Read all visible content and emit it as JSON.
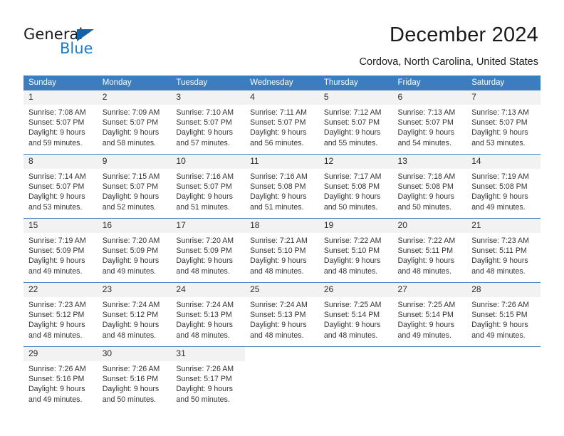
{
  "brand": {
    "name_top": "General",
    "name_bottom": "Blue",
    "accent_color": "#1363a8",
    "blue_text_color": "#1f7ac4"
  },
  "header": {
    "title": "December 2024",
    "subtitle": "Cordova, North Carolina, United States"
  },
  "calendar": {
    "header_background": "#3b7dc0",
    "header_text_color": "#ffffff",
    "daynum_background": "#f2f2f2",
    "weekdays": [
      "Sunday",
      "Monday",
      "Tuesday",
      "Wednesday",
      "Thursday",
      "Friday",
      "Saturday"
    ],
    "weeks": [
      [
        {
          "day": "1",
          "sunrise": "Sunrise: 7:08 AM",
          "sunset": "Sunset: 5:07 PM",
          "daylight_line1": "Daylight: 9 hours",
          "daylight_line2": "and 59 minutes."
        },
        {
          "day": "2",
          "sunrise": "Sunrise: 7:09 AM",
          "sunset": "Sunset: 5:07 PM",
          "daylight_line1": "Daylight: 9 hours",
          "daylight_line2": "and 58 minutes."
        },
        {
          "day": "3",
          "sunrise": "Sunrise: 7:10 AM",
          "sunset": "Sunset: 5:07 PM",
          "daylight_line1": "Daylight: 9 hours",
          "daylight_line2": "and 57 minutes."
        },
        {
          "day": "4",
          "sunrise": "Sunrise: 7:11 AM",
          "sunset": "Sunset: 5:07 PM",
          "daylight_line1": "Daylight: 9 hours",
          "daylight_line2": "and 56 minutes."
        },
        {
          "day": "5",
          "sunrise": "Sunrise: 7:12 AM",
          "sunset": "Sunset: 5:07 PM",
          "daylight_line1": "Daylight: 9 hours",
          "daylight_line2": "and 55 minutes."
        },
        {
          "day": "6",
          "sunrise": "Sunrise: 7:13 AM",
          "sunset": "Sunset: 5:07 PM",
          "daylight_line1": "Daylight: 9 hours",
          "daylight_line2": "and 54 minutes."
        },
        {
          "day": "7",
          "sunrise": "Sunrise: 7:13 AM",
          "sunset": "Sunset: 5:07 PM",
          "daylight_line1": "Daylight: 9 hours",
          "daylight_line2": "and 53 minutes."
        }
      ],
      [
        {
          "day": "8",
          "sunrise": "Sunrise: 7:14 AM",
          "sunset": "Sunset: 5:07 PM",
          "daylight_line1": "Daylight: 9 hours",
          "daylight_line2": "and 53 minutes."
        },
        {
          "day": "9",
          "sunrise": "Sunrise: 7:15 AM",
          "sunset": "Sunset: 5:07 PM",
          "daylight_line1": "Daylight: 9 hours",
          "daylight_line2": "and 52 minutes."
        },
        {
          "day": "10",
          "sunrise": "Sunrise: 7:16 AM",
          "sunset": "Sunset: 5:07 PM",
          "daylight_line1": "Daylight: 9 hours",
          "daylight_line2": "and 51 minutes."
        },
        {
          "day": "11",
          "sunrise": "Sunrise: 7:16 AM",
          "sunset": "Sunset: 5:08 PM",
          "daylight_line1": "Daylight: 9 hours",
          "daylight_line2": "and 51 minutes."
        },
        {
          "day": "12",
          "sunrise": "Sunrise: 7:17 AM",
          "sunset": "Sunset: 5:08 PM",
          "daylight_line1": "Daylight: 9 hours",
          "daylight_line2": "and 50 minutes."
        },
        {
          "day": "13",
          "sunrise": "Sunrise: 7:18 AM",
          "sunset": "Sunset: 5:08 PM",
          "daylight_line1": "Daylight: 9 hours",
          "daylight_line2": "and 50 minutes."
        },
        {
          "day": "14",
          "sunrise": "Sunrise: 7:19 AM",
          "sunset": "Sunset: 5:08 PM",
          "daylight_line1": "Daylight: 9 hours",
          "daylight_line2": "and 49 minutes."
        }
      ],
      [
        {
          "day": "15",
          "sunrise": "Sunrise: 7:19 AM",
          "sunset": "Sunset: 5:09 PM",
          "daylight_line1": "Daylight: 9 hours",
          "daylight_line2": "and 49 minutes."
        },
        {
          "day": "16",
          "sunrise": "Sunrise: 7:20 AM",
          "sunset": "Sunset: 5:09 PM",
          "daylight_line1": "Daylight: 9 hours",
          "daylight_line2": "and 49 minutes."
        },
        {
          "day": "17",
          "sunrise": "Sunrise: 7:20 AM",
          "sunset": "Sunset: 5:09 PM",
          "daylight_line1": "Daylight: 9 hours",
          "daylight_line2": "and 48 minutes."
        },
        {
          "day": "18",
          "sunrise": "Sunrise: 7:21 AM",
          "sunset": "Sunset: 5:10 PM",
          "daylight_line1": "Daylight: 9 hours",
          "daylight_line2": "and 48 minutes."
        },
        {
          "day": "19",
          "sunrise": "Sunrise: 7:22 AM",
          "sunset": "Sunset: 5:10 PM",
          "daylight_line1": "Daylight: 9 hours",
          "daylight_line2": "and 48 minutes."
        },
        {
          "day": "20",
          "sunrise": "Sunrise: 7:22 AM",
          "sunset": "Sunset: 5:11 PM",
          "daylight_line1": "Daylight: 9 hours",
          "daylight_line2": "and 48 minutes."
        },
        {
          "day": "21",
          "sunrise": "Sunrise: 7:23 AM",
          "sunset": "Sunset: 5:11 PM",
          "daylight_line1": "Daylight: 9 hours",
          "daylight_line2": "and 48 minutes."
        }
      ],
      [
        {
          "day": "22",
          "sunrise": "Sunrise: 7:23 AM",
          "sunset": "Sunset: 5:12 PM",
          "daylight_line1": "Daylight: 9 hours",
          "daylight_line2": "and 48 minutes."
        },
        {
          "day": "23",
          "sunrise": "Sunrise: 7:24 AM",
          "sunset": "Sunset: 5:12 PM",
          "daylight_line1": "Daylight: 9 hours",
          "daylight_line2": "and 48 minutes."
        },
        {
          "day": "24",
          "sunrise": "Sunrise: 7:24 AM",
          "sunset": "Sunset: 5:13 PM",
          "daylight_line1": "Daylight: 9 hours",
          "daylight_line2": "and 48 minutes."
        },
        {
          "day": "25",
          "sunrise": "Sunrise: 7:24 AM",
          "sunset": "Sunset: 5:13 PM",
          "daylight_line1": "Daylight: 9 hours",
          "daylight_line2": "and 48 minutes."
        },
        {
          "day": "26",
          "sunrise": "Sunrise: 7:25 AM",
          "sunset": "Sunset: 5:14 PM",
          "daylight_line1": "Daylight: 9 hours",
          "daylight_line2": "and 48 minutes."
        },
        {
          "day": "27",
          "sunrise": "Sunrise: 7:25 AM",
          "sunset": "Sunset: 5:14 PM",
          "daylight_line1": "Daylight: 9 hours",
          "daylight_line2": "and 49 minutes."
        },
        {
          "day": "28",
          "sunrise": "Sunrise: 7:26 AM",
          "sunset": "Sunset: 5:15 PM",
          "daylight_line1": "Daylight: 9 hours",
          "daylight_line2": "and 49 minutes."
        }
      ],
      [
        {
          "day": "29",
          "sunrise": "Sunrise: 7:26 AM",
          "sunset": "Sunset: 5:16 PM",
          "daylight_line1": "Daylight: 9 hours",
          "daylight_line2": "and 49 minutes."
        },
        {
          "day": "30",
          "sunrise": "Sunrise: 7:26 AM",
          "sunset": "Sunset: 5:16 PM",
          "daylight_line1": "Daylight: 9 hours",
          "daylight_line2": "and 50 minutes."
        },
        {
          "day": "31",
          "sunrise": "Sunrise: 7:26 AM",
          "sunset": "Sunset: 5:17 PM",
          "daylight_line1": "Daylight: 9 hours",
          "daylight_line2": "and 50 minutes."
        },
        {
          "day": "",
          "sunrise": "",
          "sunset": "",
          "daylight_line1": "",
          "daylight_line2": ""
        },
        {
          "day": "",
          "sunrise": "",
          "sunset": "",
          "daylight_line1": "",
          "daylight_line2": ""
        },
        {
          "day": "",
          "sunrise": "",
          "sunset": "",
          "daylight_line1": "",
          "daylight_line2": ""
        },
        {
          "day": "",
          "sunrise": "",
          "sunset": "",
          "daylight_line1": "",
          "daylight_line2": ""
        }
      ]
    ]
  }
}
